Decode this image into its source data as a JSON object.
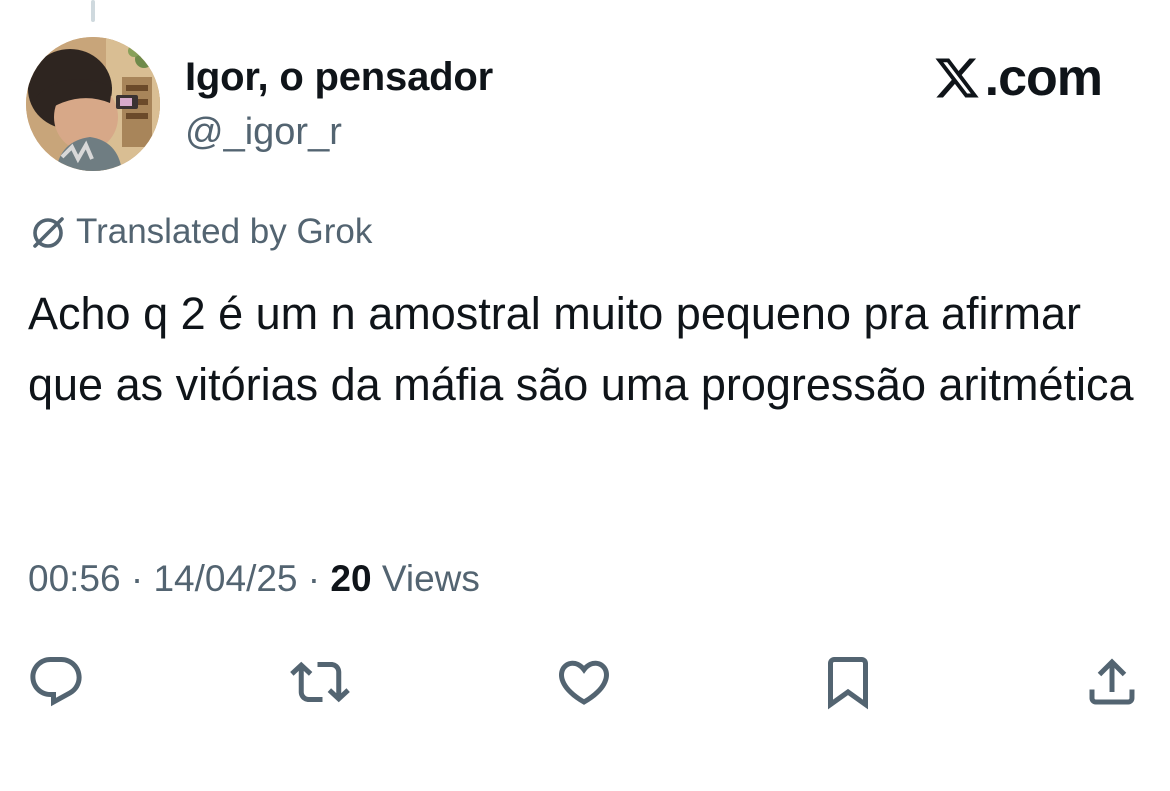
{
  "tweet": {
    "author": {
      "display_name": "Igor, o pensador",
      "handle": "@_igor_r"
    },
    "brand": {
      "logo_icon": "x-logo-icon",
      "suffix": ".com"
    },
    "translation": {
      "icon": "grok-icon",
      "label": "Translated by Grok"
    },
    "text": "Acho q 2 é um n amostral muito pequeno pra afirmar que as vitórias da máfia são uma progressão aritmética",
    "meta": {
      "time": "00:56",
      "separator": "·",
      "date": "14/04/25",
      "views_count": "20",
      "views_label": "Views"
    },
    "actions": [
      {
        "name": "reply",
        "icon": "reply-icon"
      },
      {
        "name": "repost",
        "icon": "repost-icon"
      },
      {
        "name": "like",
        "icon": "heart-icon"
      },
      {
        "name": "bookmark",
        "icon": "bookmark-icon"
      },
      {
        "name": "share",
        "icon": "share-icon"
      }
    ]
  },
  "colors": {
    "text_primary": "#0f1419",
    "text_secondary": "#536471",
    "thread_line": "#cfd9de"
  }
}
